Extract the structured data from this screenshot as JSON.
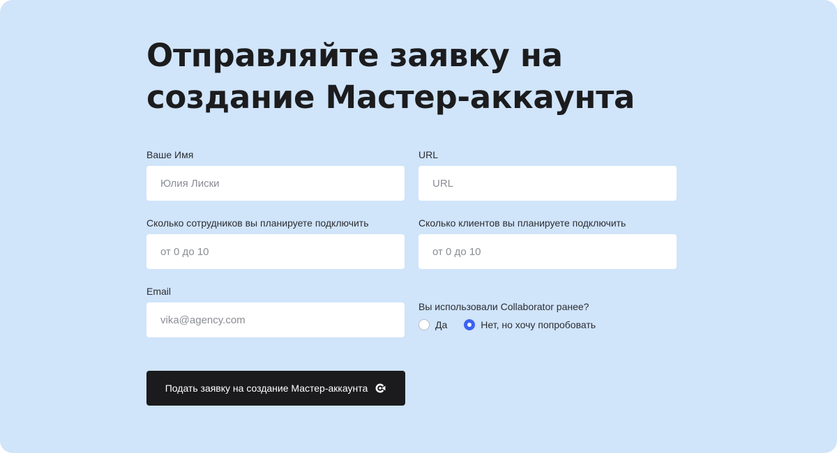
{
  "page": {
    "title_line1": "Отправляйте заявку на",
    "title_line2": "создание Мастер-аккаунта"
  },
  "form": {
    "name": {
      "label": "Ваше Имя",
      "placeholder": "Юлия Лиски",
      "value": ""
    },
    "url": {
      "label": "URL",
      "placeholder": "URL",
      "value": ""
    },
    "employees": {
      "label": "Сколько сотрудников вы планируете подключить",
      "placeholder": "от 0 до 10",
      "value": ""
    },
    "clients": {
      "label": "Сколько клиентов вы планируете подключить",
      "placeholder": "от 0 до 10",
      "value": ""
    },
    "email": {
      "label": "Email",
      "placeholder": "vika@agency.com",
      "value": ""
    },
    "used_before": {
      "question": "Вы использовали Collaborator ранее?",
      "options": [
        {
          "label": "Да",
          "checked": false
        },
        {
          "label": "Нет, но хочу попробовать",
          "checked": true
        }
      ]
    },
    "submit": {
      "label": "Подать заявку на создание Мастер-аккаунта",
      "icon": "collaborator-logo-icon"
    }
  },
  "colors": {
    "background": "#d0e4fa",
    "button": "#1b1b1d",
    "accent": "#3b63f3",
    "input": "#ffffff"
  }
}
